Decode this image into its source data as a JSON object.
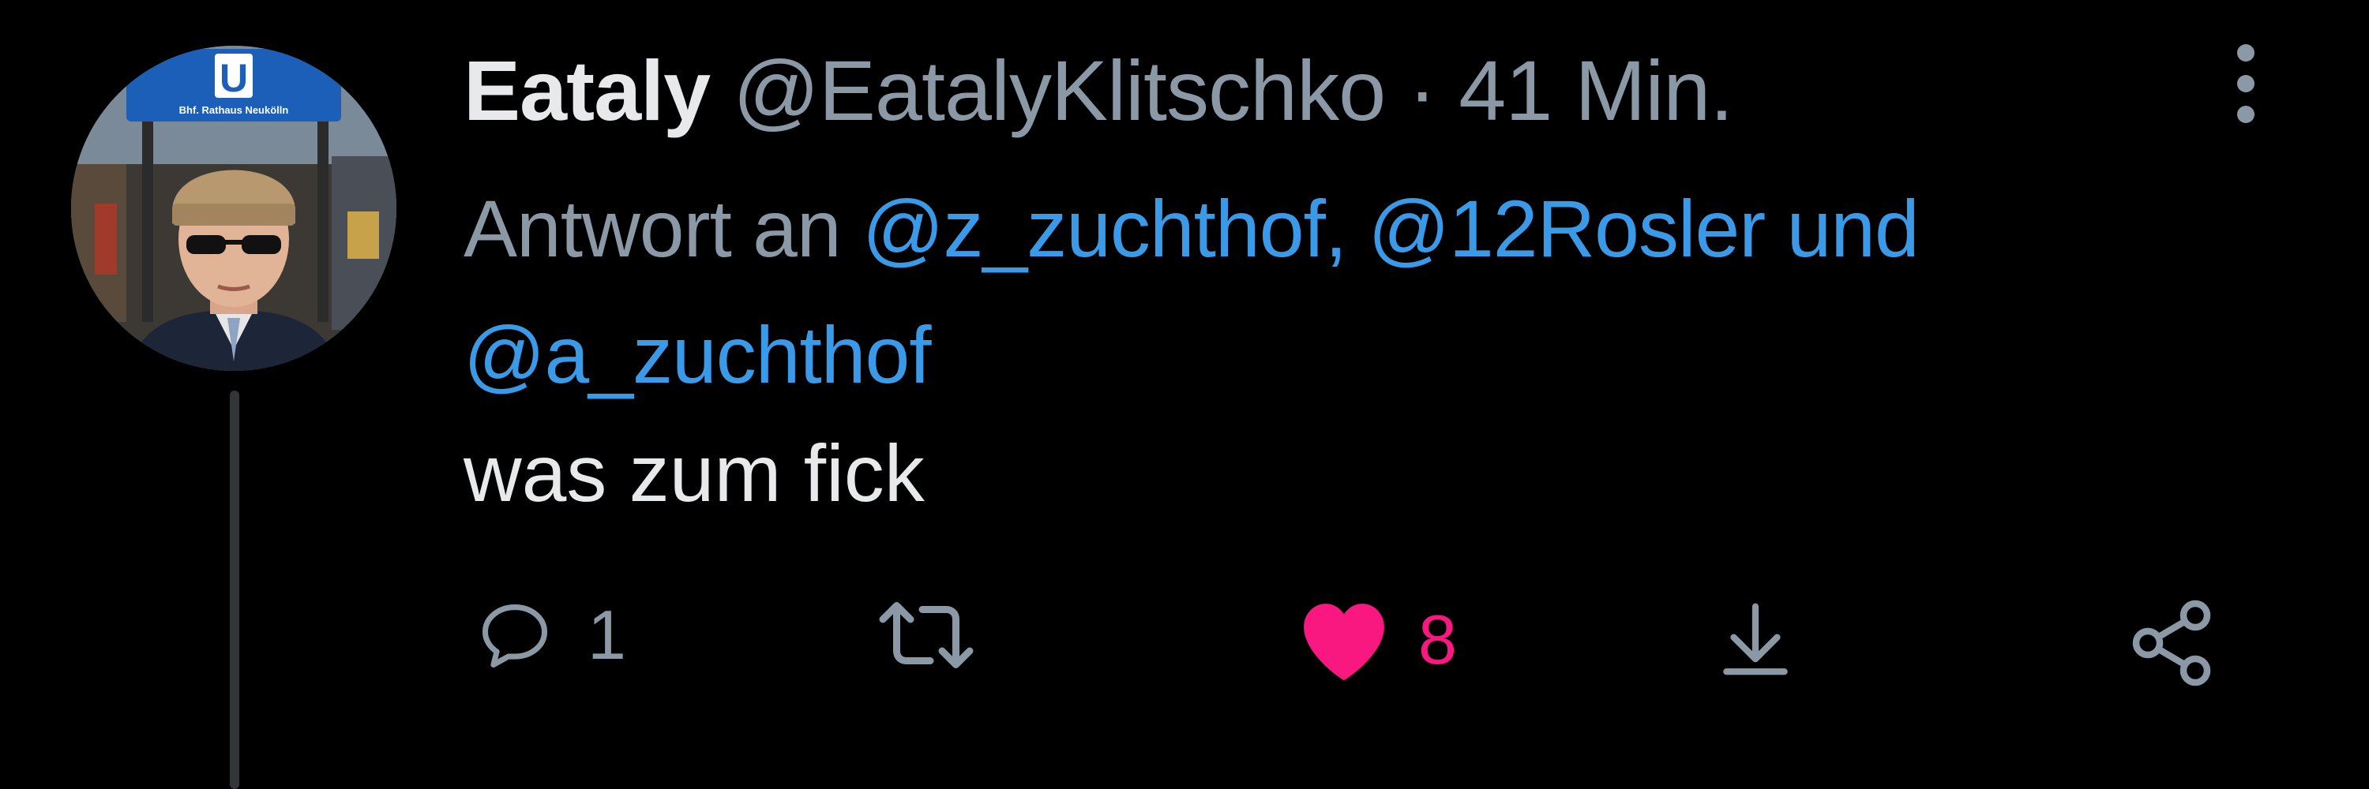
{
  "tweet": {
    "display_name": "Eataly",
    "handle": "@EatalyKlitschko",
    "separator": "·",
    "timestamp": "41 Min.",
    "reply_prefix": "Antwort an",
    "mention_1": "@z_zuchthof,",
    "mention_2": "@12Rosler",
    "mention_join": "und",
    "mention_3": "@a_zuchthof",
    "text": "was zum fick"
  },
  "avatar": {
    "sign_letter": "U",
    "sign_text": "Bhf. Rathaus Neukölln"
  },
  "actions": {
    "reply_count": "1",
    "like_count": "8",
    "liked": true
  },
  "colors": {
    "background": "#000000",
    "primary_text": "#e7e9ea",
    "secondary_text": "#8b98a5",
    "mention": "#3b9ae8",
    "like": "#f91880"
  },
  "icons": [
    "reply-icon",
    "retweet-icon",
    "heart-icon",
    "download-icon",
    "share-icon",
    "more-options-icon"
  ]
}
